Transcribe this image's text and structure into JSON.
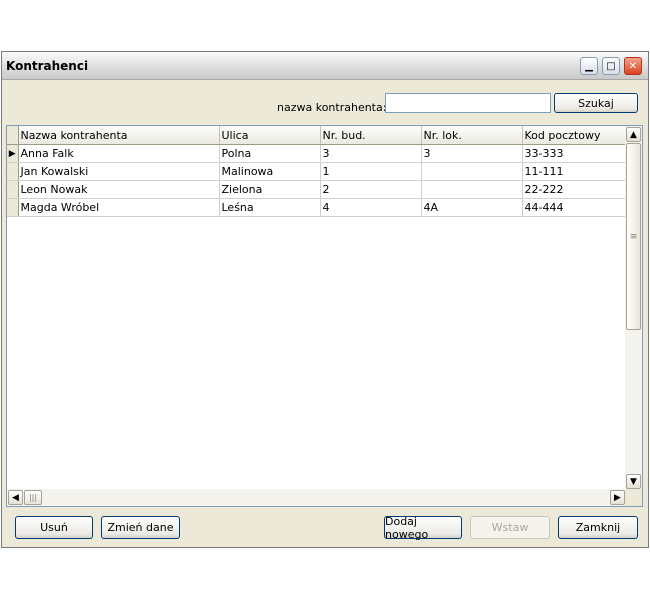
{
  "window": {
    "title": "Kontrahenci"
  },
  "search": {
    "label": "nazwa kontrahenta:",
    "value": "",
    "button": "Szukaj"
  },
  "table": {
    "columns": [
      "Nazwa kontrahenta",
      "Ulica",
      "Nr. bud.",
      "Nr. lok.",
      "Kod pocztowy"
    ],
    "rows": [
      [
        "Anna Falk",
        "Polna",
        "3",
        "3",
        "33-333"
      ],
      [
        "Jan Kowalski",
        "Malinowa",
        "1",
        "",
        "11-111"
      ],
      [
        "Leon Nowak",
        "Zielona",
        "2",
        "",
        "22-222"
      ],
      [
        "Magda Wróbel",
        "Leśna",
        "4",
        "4A",
        "44-444"
      ]
    ],
    "current_row_index": 0
  },
  "footer": {
    "delete": "Usuń",
    "edit": "Zmień dane",
    "add_new": "Dodaj nowego",
    "insert": "Wstaw",
    "close": "Zamknij"
  },
  "colors": {
    "title_bg": "#dcdcdc",
    "dialog_bg": "#ece9d8",
    "close_btn": "#d6431f"
  }
}
